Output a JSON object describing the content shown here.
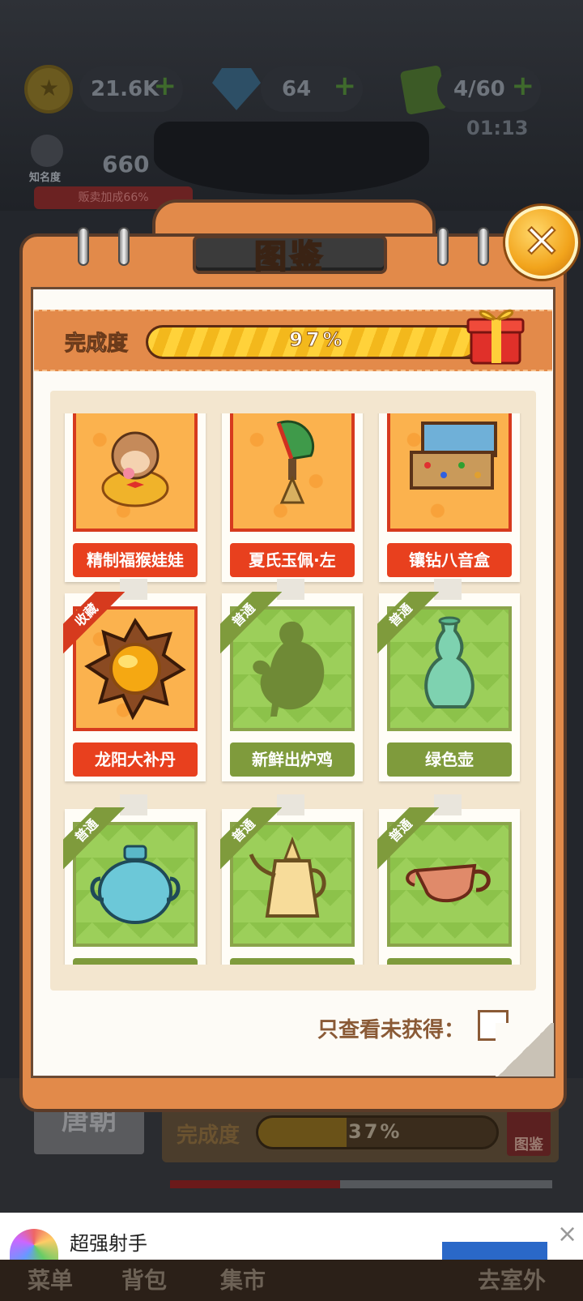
{
  "hud": {
    "gold": "21.6K",
    "gems": "64",
    "energy": "4/60",
    "energy_timer": "01:13",
    "fame_label": "知名度",
    "fame_value": "660",
    "sale_bonus": "贩卖加成66%"
  },
  "background": {
    "dynasty_tab": "唐朝",
    "completion_label": "完成度",
    "completion_percent": "37%",
    "completion_value": 0.37,
    "book_label": "图鉴"
  },
  "modal": {
    "title": "图鉴",
    "completion_label": "完成度",
    "completion_percent": "97%",
    "completion_value": 0.97,
    "filter_label": "只查看未获得：",
    "filter_checked": false
  },
  "cards": [
    {
      "name": "精制福猴娃娃",
      "rarity": "collect",
      "icon": "monkey-doll-icon"
    },
    {
      "name": "夏氏玉佩·左",
      "rarity": "collect",
      "icon": "jade-pendant-icon"
    },
    {
      "name": "镶钻八音盒",
      "rarity": "collect",
      "icon": "music-box-icon"
    },
    {
      "name": "龙阳大补丹",
      "rarity": "collect",
      "ribbon": "收藏",
      "icon": "elixir-pill-icon"
    },
    {
      "name": "新鲜出炉鸡",
      "rarity": "common",
      "ribbon": "普通",
      "icon": "chicken-icon"
    },
    {
      "name": "绿色壶",
      "rarity": "common",
      "ribbon": "普通",
      "icon": "green-vase-icon"
    },
    {
      "name": "",
      "rarity": "common",
      "ribbon": "普通",
      "icon": "teal-jar-icon"
    },
    {
      "name": "",
      "rarity": "common",
      "ribbon": "普通",
      "icon": "gold-teapot-icon"
    },
    {
      "name": "",
      "rarity": "common",
      "ribbon": "普通",
      "icon": "clay-pot-icon"
    }
  ],
  "ad": {
    "title": "超强射手"
  },
  "nav": {
    "menu": "菜单",
    "bag": "背包",
    "market": "集市",
    "outdoor": "去室外"
  },
  "colors": {
    "frame_orange": "#e28a4a",
    "collect_red": "#d63a1e",
    "common_green": "#7f9b3c",
    "progress_gold": "#ffd23a"
  }
}
